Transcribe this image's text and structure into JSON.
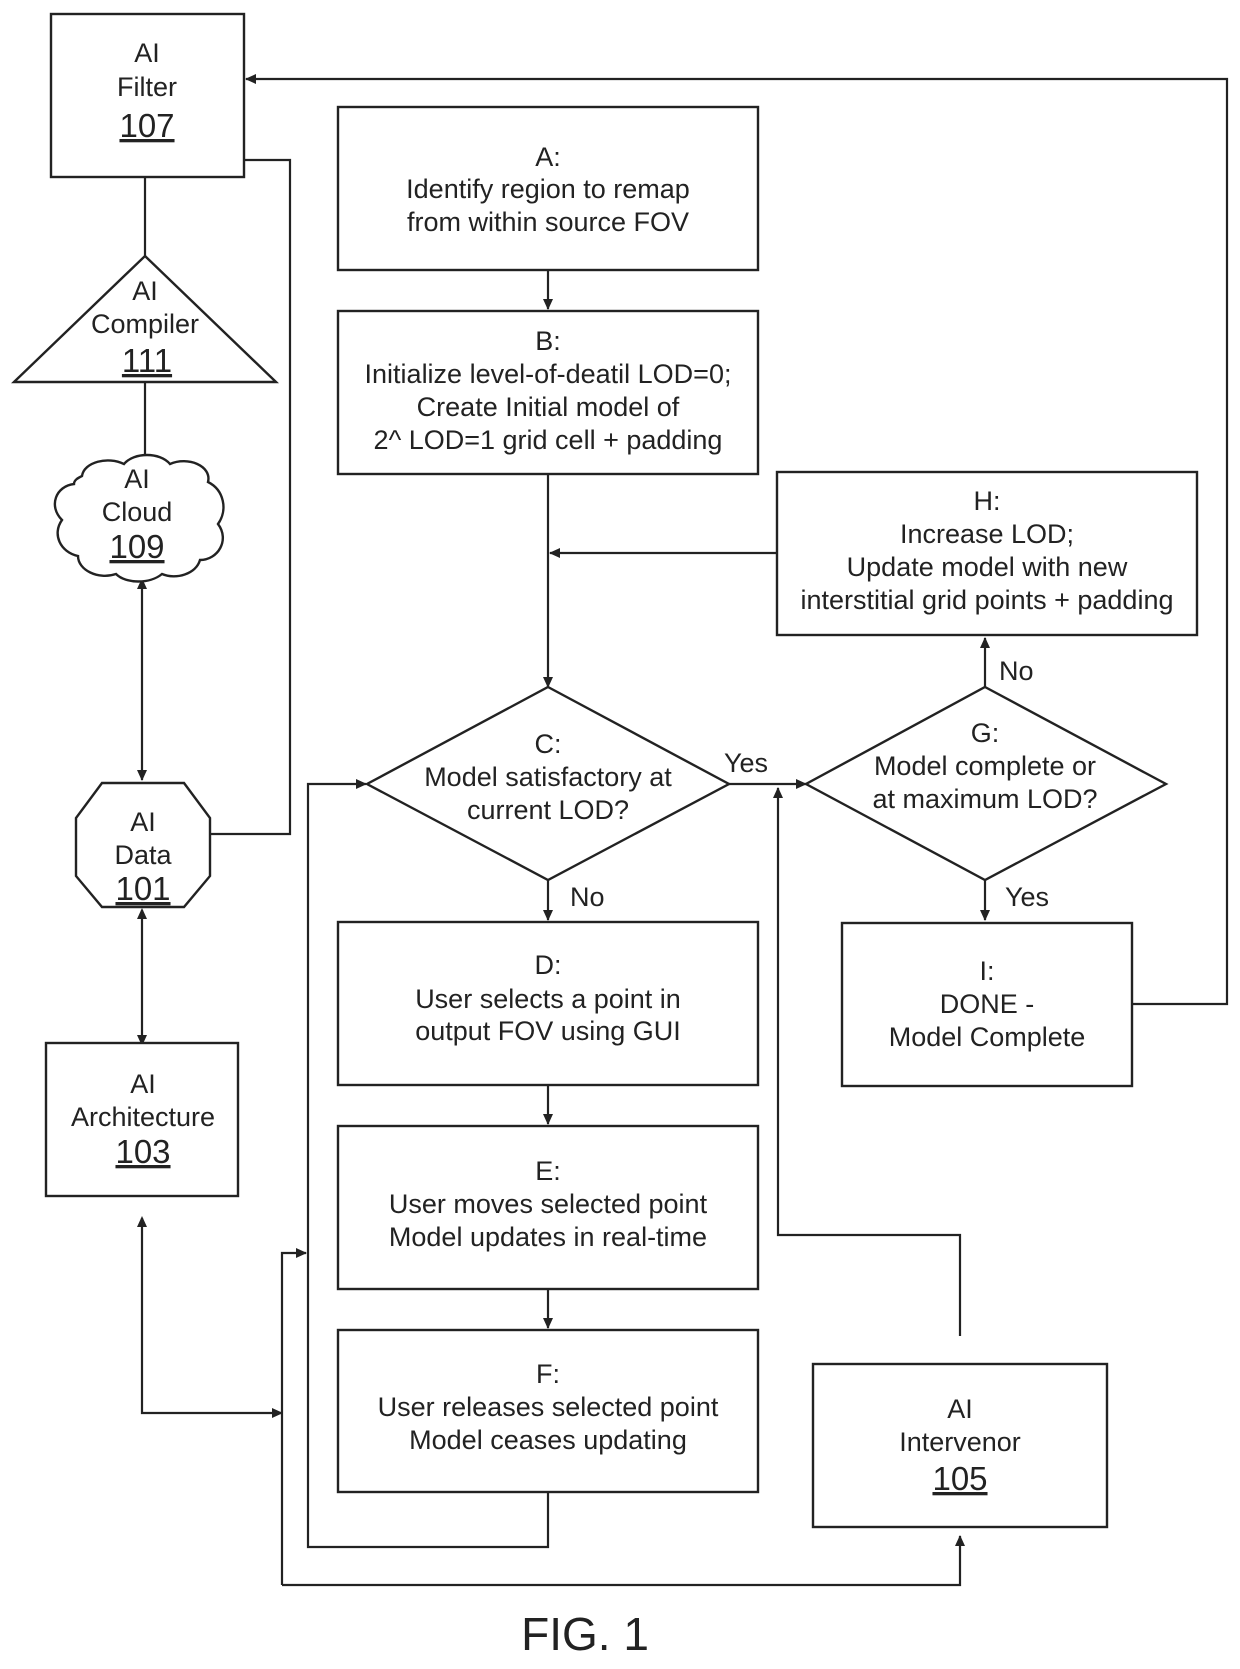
{
  "figure": {
    "caption": "FIG. 1"
  },
  "components": {
    "filter": {
      "line1": "AI",
      "line2": "Filter",
      "ref": "107"
    },
    "compiler": {
      "line1": "AI",
      "line2": "Compiler",
      "ref": "111"
    },
    "cloud": {
      "line1": "AI",
      "line2": "Cloud",
      "ref": "109"
    },
    "data": {
      "line1": "AI",
      "line2": "Data",
      "ref": "101"
    },
    "architecture": {
      "line1": "AI",
      "line2": "Architecture",
      "ref": "103"
    },
    "intervenor": {
      "line1": "AI",
      "line2": "Intervenor",
      "ref": "105"
    }
  },
  "steps": {
    "A": {
      "id": "A:",
      "lines": [
        "Identify region to remap",
        "from within source FOV"
      ]
    },
    "B": {
      "id": "B:",
      "lines": [
        "Initialize level-of-deatil LOD=0;",
        "Create Initial model of",
        "2^ LOD=1 grid cell + padding"
      ]
    },
    "C": {
      "id": "C:",
      "lines": [
        "Model satisfactory at",
        "current LOD?"
      ]
    },
    "D": {
      "id": "D:",
      "lines": [
        "User selects a point in",
        "output FOV using GUI"
      ]
    },
    "E": {
      "id": "E:",
      "lines": [
        "User moves selected point",
        "Model updates in real-time"
      ]
    },
    "F": {
      "id": "F:",
      "lines": [
        "User releases selected point",
        "Model ceases updating"
      ]
    },
    "G": {
      "id": "G:",
      "lines": [
        "Model complete or",
        "at maximum LOD?"
      ]
    },
    "H": {
      "id": "H:",
      "lines": [
        "Increase LOD;",
        "Update model with new",
        "interstitial grid points + padding"
      ]
    },
    "I": {
      "id": "I:",
      "lines": [
        "DONE -",
        "Model Complete"
      ]
    }
  },
  "edge_labels": {
    "c_yes": "Yes",
    "c_no": "No",
    "g_no": "No",
    "g_yes": "Yes"
  }
}
